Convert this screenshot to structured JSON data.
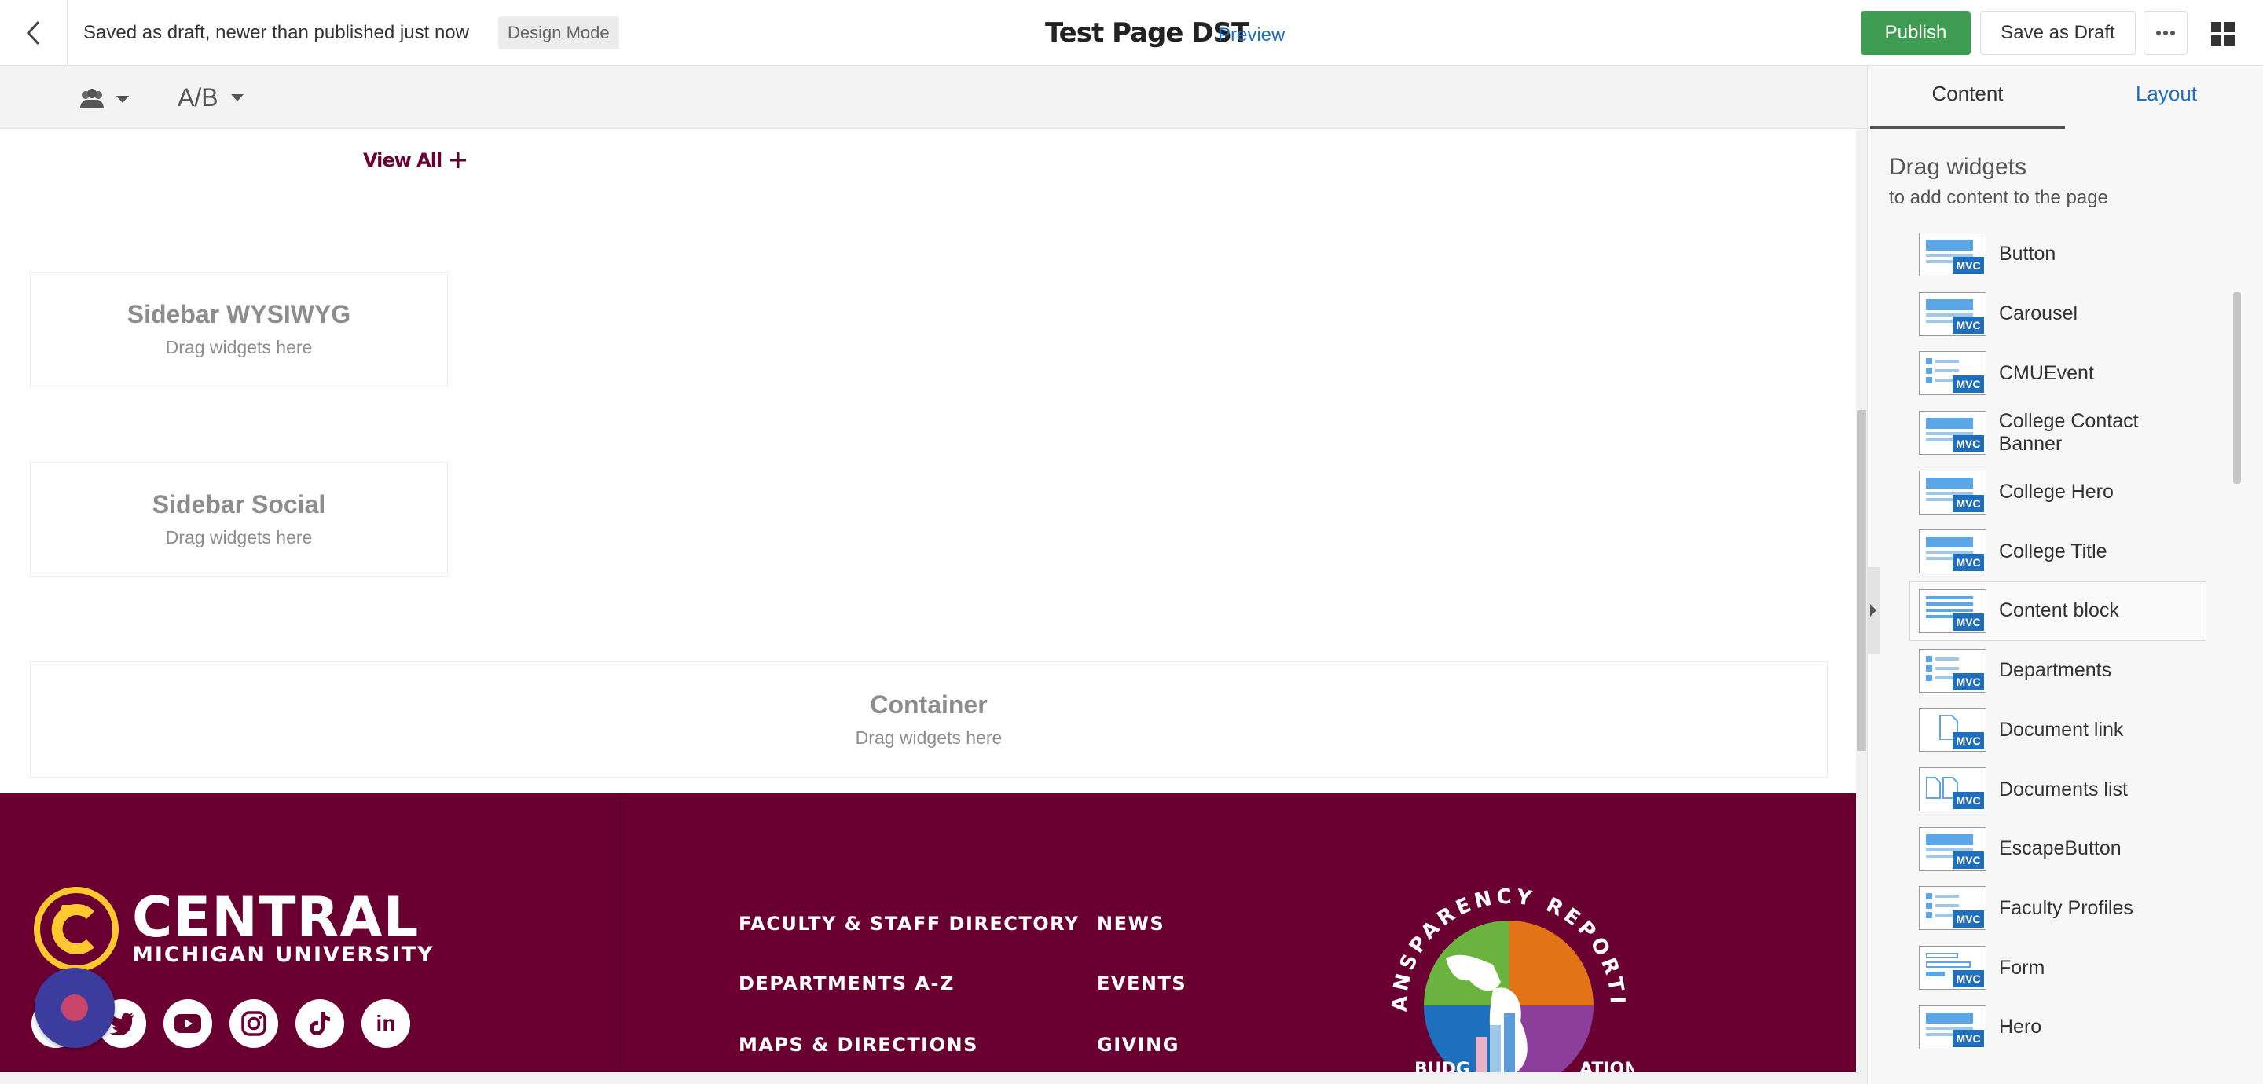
{
  "topbar": {
    "status_text": "Saved as draft, newer than published just now",
    "mode_badge": "Design Mode",
    "page_title": "Test Page DST",
    "preview_label": "Preview",
    "publish_label": "Publish",
    "save_draft_label": "Save as Draft",
    "more_label": "•••"
  },
  "subtoolbar": {
    "ab_label": "A/B"
  },
  "canvas": {
    "view_all_label": "View All",
    "zones": [
      {
        "title": "Sidebar WYSIWYG",
        "hint": "Drag widgets here"
      },
      {
        "title": "Sidebar Social",
        "hint": "Drag widgets here"
      },
      {
        "title": "Container",
        "hint": "Drag widgets here"
      }
    ]
  },
  "footer": {
    "logo_line1": "CENTRAL",
    "logo_line2": "MICHIGAN UNIVERSITY",
    "social": [
      "f",
      "t",
      "yt",
      "ig",
      "tt",
      "in"
    ],
    "links_col1": [
      "FACULTY & STAFF DIRECTORY",
      "DEPARTMENTS A-Z",
      "MAPS & DIRECTIONS"
    ],
    "links_col2": [
      "NEWS",
      "EVENTS",
      "GIVING"
    ],
    "badge_text": "TRANSPARENCY REPORTING",
    "badge_text_bottom": "BUDG ATION",
    "brand_color": "#6a0032"
  },
  "panel": {
    "tab_content": "Content",
    "tab_layout": "Layout",
    "heading": "Drag widgets",
    "subheading": "to add content to the page",
    "mvc_tag": "MVC",
    "widgets": [
      {
        "label": "Button",
        "icon": "wide"
      },
      {
        "label": "Carousel",
        "icon": "wide"
      },
      {
        "label": "CMUEvent",
        "icon": "list"
      },
      {
        "label": "College Contact Banner",
        "icon": "wide"
      },
      {
        "label": "College Hero",
        "icon": "wide"
      },
      {
        "label": "College Title",
        "icon": "wide"
      },
      {
        "label": "Content block",
        "icon": "lines"
      },
      {
        "label": "Departments",
        "icon": "list"
      },
      {
        "label": "Document link",
        "icon": "doc"
      },
      {
        "label": "Documents list",
        "icon": "docs"
      },
      {
        "label": "EscapeButton",
        "icon": "wide"
      },
      {
        "label": "Faculty Profiles",
        "icon": "list"
      },
      {
        "label": "Form",
        "icon": "form"
      },
      {
        "label": "Hero",
        "icon": "wide"
      }
    ]
  }
}
